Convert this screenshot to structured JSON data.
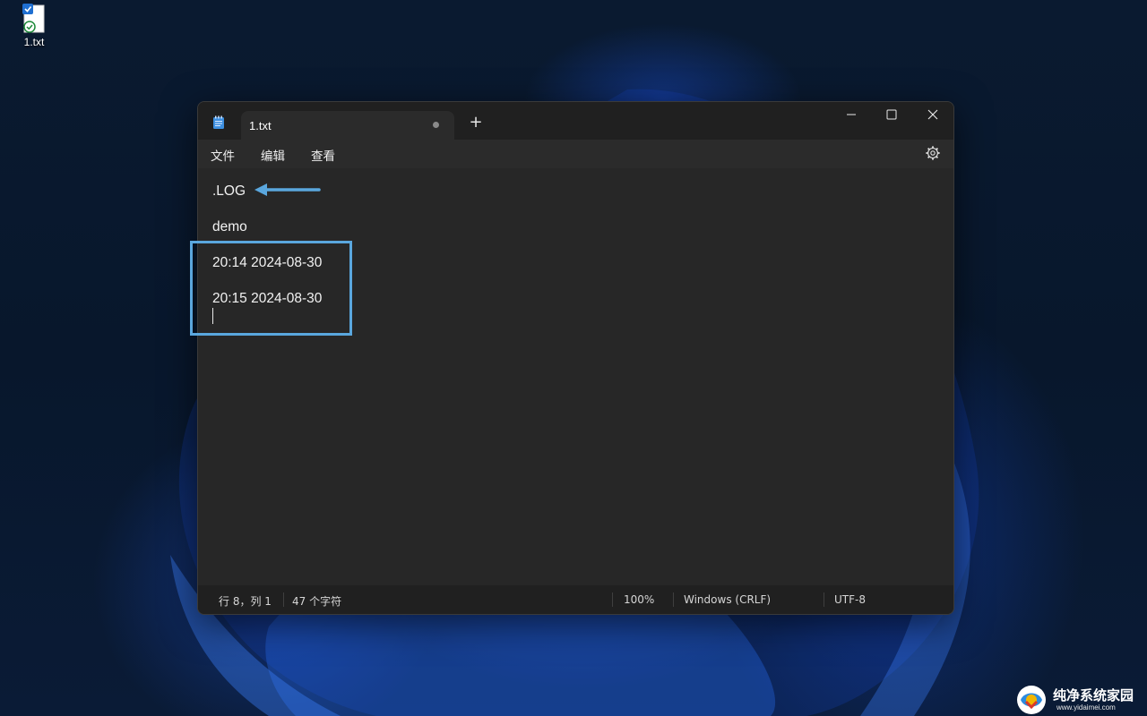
{
  "desktop": {
    "icon_label": "1.txt"
  },
  "window": {
    "tab": {
      "title": "1.txt",
      "unsaved": true
    },
    "new_tab_glyph": "+",
    "menu": [
      "文件",
      "编辑",
      "查看"
    ],
    "icons": {
      "app": "notepad-icon",
      "minimize": "minimize-icon",
      "maximize": "maximize-icon",
      "close": "close-icon",
      "settings": "gear-icon"
    }
  },
  "editor": {
    "lines": [
      ".LOG",
      "demo",
      "20:14 2024-08-30",
      "20:15 2024-08-30"
    ]
  },
  "statusbar": {
    "position": "行 8，列 1",
    "char_count": "47 个字符",
    "zoom": "100%",
    "line_ending": "Windows (CRLF)",
    "encoding": "UTF-8"
  },
  "annotations": {
    "accent_color": "#5aa7de"
  },
  "watermark": {
    "title": "纯净系统家园",
    "url": "www.yidaimei.com"
  }
}
